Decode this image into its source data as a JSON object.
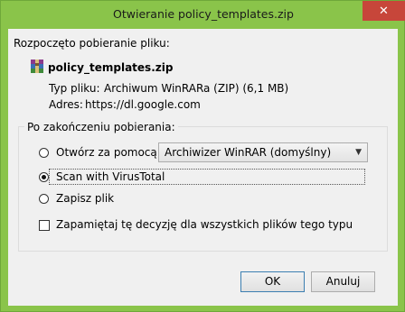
{
  "window": {
    "title": "Otwieranie policy_templates.zip"
  },
  "header": {
    "started": "Rozpoczęto pobieranie pliku:"
  },
  "file": {
    "name": "policy_templates.zip",
    "type_label": "Typ pliku:",
    "type_value": "Archiwum WinRARa (ZIP) (6,1 MB)",
    "address_label": "Adres:",
    "address_value": "https://dl.google.com"
  },
  "group": {
    "label": "Po zakończeniu pobierania:",
    "options": [
      {
        "label": "Otwórz za pomocą",
        "selected": false
      },
      {
        "label": "Scan with VirusTotal",
        "selected": true
      },
      {
        "label": "Zapisz plik",
        "selected": false
      }
    ],
    "open_with_value": "Archiwizer WinRAR (domyślny)",
    "remember_label": "Zapamiętaj tę decyzję dla wszystkich plików tego typu",
    "remember_checked": false
  },
  "buttons": {
    "ok": "OK",
    "cancel": "Anuluj"
  },
  "colors": {
    "frame": "#8ac44a",
    "close": "#c7463a",
    "client": "#f0f0f0"
  }
}
